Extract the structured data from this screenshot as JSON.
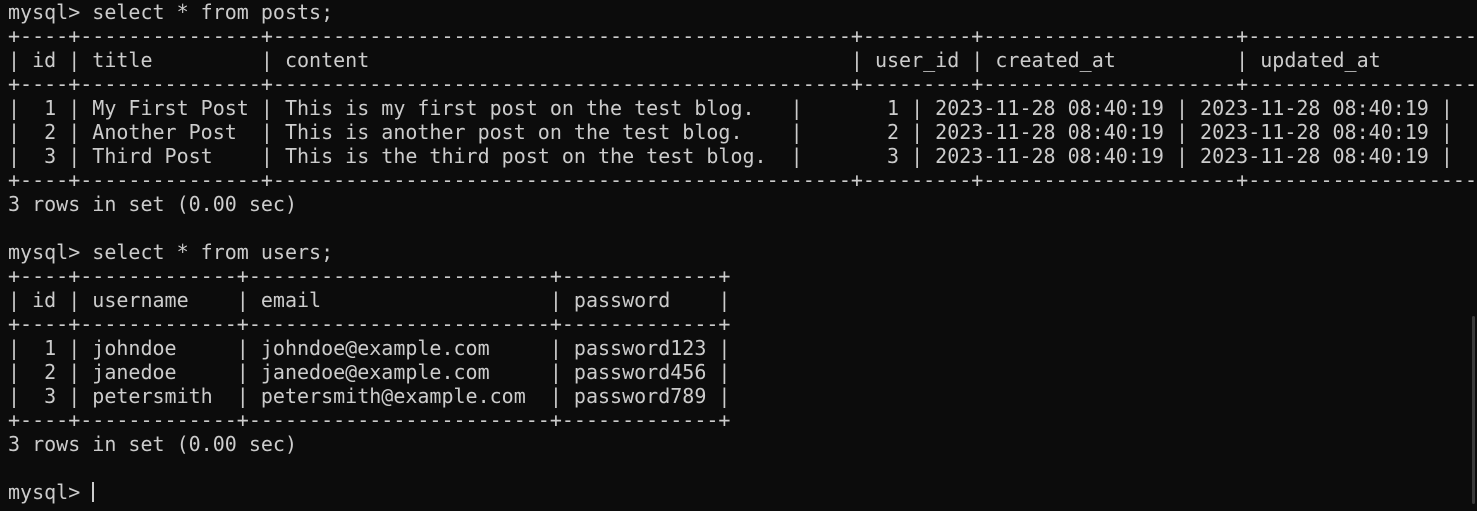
{
  "terminal": {
    "lines": [
      "mysql> select * from posts;",
      "+----+---------------+------------------------------------------------+---------+---------------------+---------------------+",
      "| id | title         | content                                        | user_id | created_at          | updated_at          |",
      "+----+---------------+------------------------------------------------+---------+---------------------+---------------------+",
      "|  1 | My First Post | This is my first post on the test blog.   |       1 | 2023-11-28 08:40:19 | 2023-11-28 08:40:19 |",
      "|  2 | Another Post  | This is another post on the test blog.    |       2 | 2023-11-28 08:40:19 | 2023-11-28 08:40:19 |",
      "|  3 | Third Post    | This is the third post on the test blog.  |       3 | 2023-11-28 08:40:19 | 2023-11-28 08:40:19 |",
      "+----+---------------+------------------------------------------------+---------+---------------------+---------------------+",
      "3 rows in set (0.00 sec)",
      "",
      "mysql> select * from users;",
      "+----+-------------+-------------------------+-------------+",
      "| id | username    | email                   | password    |",
      "+----+-------------+-------------------------+-------------+",
      "|  1 | johndoe     | johndoe@example.com     | password123 |",
      "|  2 | janedoe     | janedoe@example.com     | password456 |",
      "|  3 | petersmith  | petersmith@example.com  | password789 |",
      "+----+-------------+-------------------------+-------------+",
      "3 rows in set (0.00 sec)",
      "",
      "mysql> "
    ]
  }
}
